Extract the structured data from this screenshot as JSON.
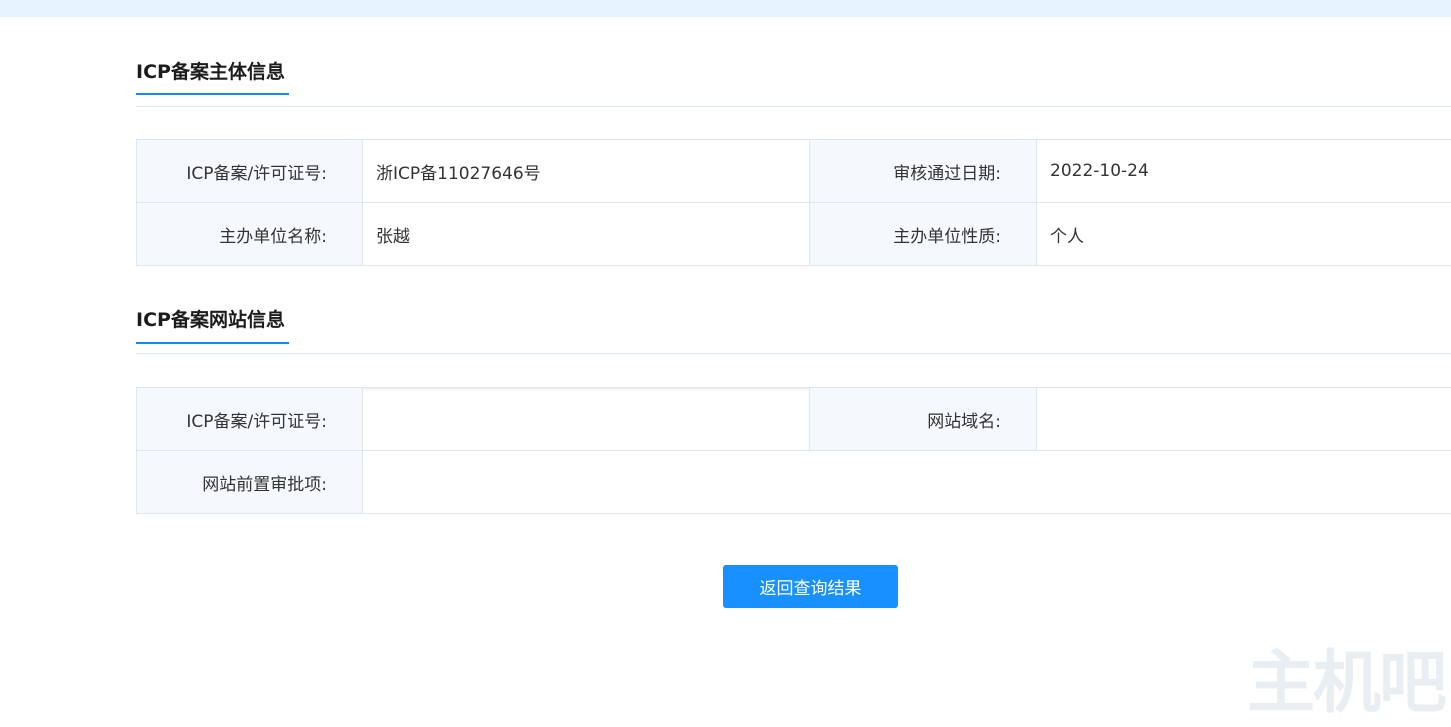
{
  "sections": {
    "subject": {
      "title": "ICP备案主体信息",
      "rows": [
        [
          {
            "label": "ICP备案/许可证号:",
            "value": "浙ICP备11027646号"
          },
          {
            "label": "审核通过日期:",
            "value": "2022-10-24"
          }
        ],
        [
          {
            "label": "主办单位名称:",
            "value": "张越"
          },
          {
            "label": "主办单位性质:",
            "value": "个人"
          }
        ]
      ]
    },
    "website": {
      "title": "ICP备案网站信息",
      "rows": [
        [
          {
            "label": "ICP备案/许可证号:",
            "value": ""
          },
          {
            "label": "网站域名:",
            "value": ""
          }
        ],
        [
          {
            "label": "网站前置审批项:",
            "value": ""
          }
        ]
      ]
    }
  },
  "actions": {
    "back_label": "返回查询结果"
  },
  "watermark": {
    "text": "主机吧"
  },
  "colors": {
    "accent": "#1890ff",
    "title_underline": "#1589f2",
    "top_bar": "#e6f2fd",
    "label_cell_bg": "#f5f9fd",
    "border": "#dfe6ec"
  }
}
